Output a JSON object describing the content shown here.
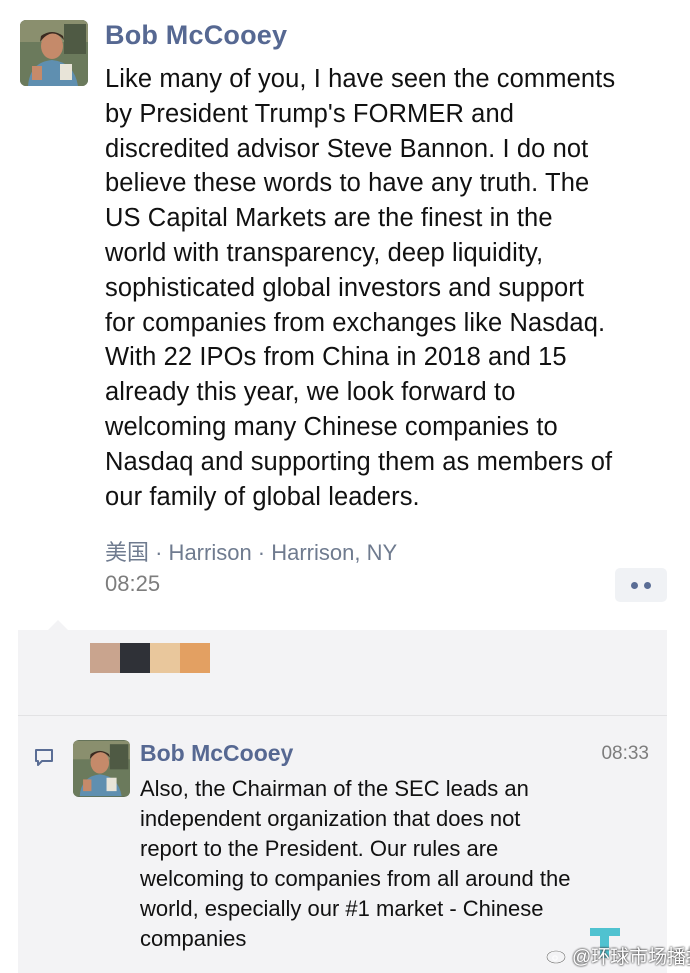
{
  "post": {
    "author": "Bob McCooey",
    "text": "Like many of you, I have seen the comments\nby President Trump's FORMER and\ndiscredited advisor Steve Bannon. I do not\nbelieve these words to have any truth. The\nUS Capital Markets are the finest in the\nworld with transparency, deep liquidity,\nsophisticated global investors and support\nfor companies from exchanges like Nasdaq.\nWith 22 IPOs from China in 2018 and 15\nalready this year, we look forward to\nwelcoming many Chinese companies to\nNasdaq and supporting them as members of\n our family of global leaders.",
    "location": "美国 · Harrison · Harrison, NY",
    "time": "08:25",
    "more_icon": "ellipsis-icon"
  },
  "likes": {
    "swatches": [
      "#c9a48e",
      "#2f3137",
      "#e9c79c",
      "#e3a062"
    ]
  },
  "comment": {
    "author": "Bob McCooey",
    "time": "08:33",
    "text": "Also, the Chairman of the SEC leads an\nindependent organization that does not\nreport to the President. Our rules are\nwelcoming to companies from all around the\nworld, especially our #1 market - Chinese\ncompanies",
    "icon": "comment-bubble-icon"
  },
  "watermark": {
    "text": "@环球市场播报",
    "logo": "weibo-logo"
  },
  "colors": {
    "name_blue": "#566892",
    "location_gray": "#6f7b8f",
    "panel_bg": "#f3f3f5"
  }
}
